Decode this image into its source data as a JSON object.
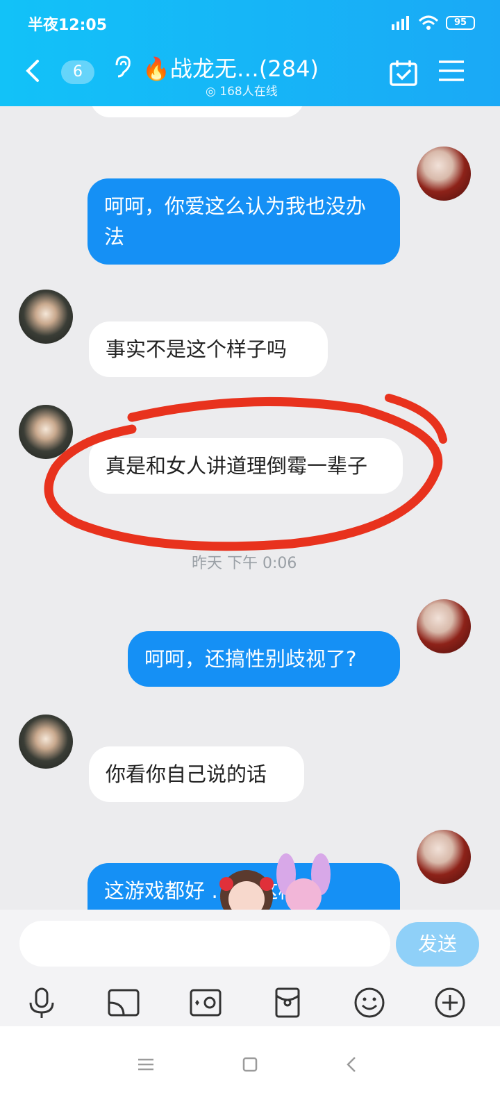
{
  "status_bar": {
    "time": "半夜12:05",
    "battery": "95"
  },
  "header": {
    "unread_count": "6",
    "group_title": "战龙无…",
    "member_count": "(284)",
    "online": "168人在线"
  },
  "messages": [
    {
      "from": "me",
      "text": "呵呵，你爱这么认为我也没办法"
    },
    {
      "from": "other",
      "text": "事实不是这个样子吗"
    },
    {
      "from": "other",
      "text": "真是和女人讲道理倒霉一辈子"
    },
    {
      "from": "me",
      "text": "呵呵，还搞性别歧视了?"
    },
    {
      "from": "other",
      "text": "你看你自己说的话"
    },
    {
      "from": "me",
      "text": "这游戏都好 … 就这样"
    }
  ],
  "timestamp": "昨天 下午 0:06",
  "composer": {
    "placeholder": "",
    "send_label": "发送"
  },
  "colors": {
    "header": "#1aa9f6",
    "my_bubble": "#1590f5",
    "annotation": "#e8321d",
    "send": "#8fd0f8"
  },
  "toolbar_icons": [
    "microphone-icon",
    "screen-share-icon",
    "camera-icon",
    "red-envelope-icon",
    "emoji-icon",
    "plus-icon"
  ]
}
